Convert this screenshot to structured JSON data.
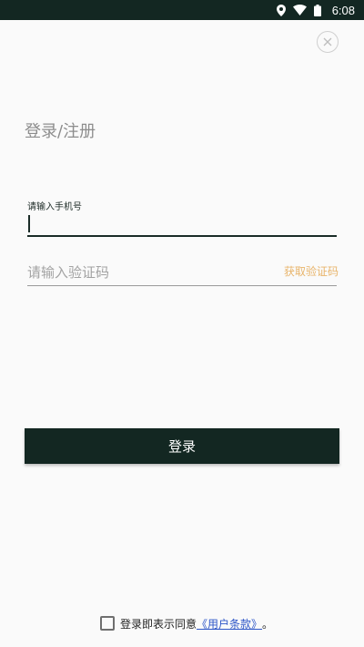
{
  "status_bar": {
    "time": "6:08",
    "icons": [
      "location-icon",
      "wifi-icon",
      "battery-icon"
    ]
  },
  "header": {
    "title": "登录/注册"
  },
  "phone": {
    "label": "请输入手机号",
    "value": ""
  },
  "code": {
    "placeholder": "请输入验证码",
    "get_code_label": "获取验证码"
  },
  "login": {
    "button_label": "登录"
  },
  "agreement": {
    "checked": false,
    "prefix": "登录即表示同意",
    "link_text": "《用户条款》",
    "suffix": "。"
  },
  "colors": {
    "primary": "#132722",
    "accent": "#e8b46a",
    "link": "#2f57c8",
    "background": "#fafafa"
  }
}
